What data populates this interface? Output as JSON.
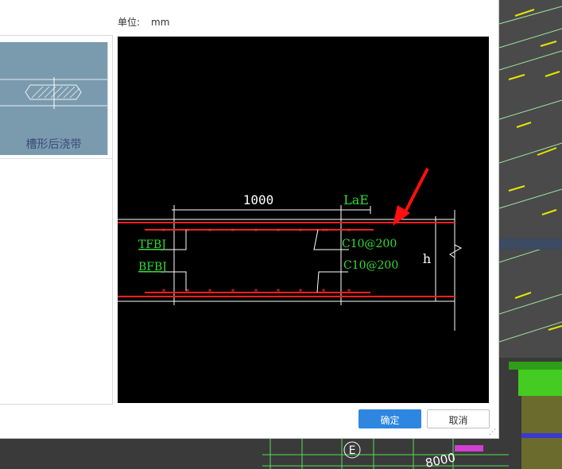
{
  "dialog": {
    "unit_label": "单位:",
    "unit_value": "mm",
    "thumbnail_label": "槽形后浇带",
    "ok_label": "确定",
    "cancel_label": "取消"
  },
  "drawing": {
    "dim_width": "1000",
    "dim_lae": "LaE",
    "top_bar_label": "TFBJ",
    "bottom_bar_label": "BFBJ",
    "top_stirrup_label": "C10@200",
    "bottom_stirrup_label": "C10@200",
    "height_label": "h"
  },
  "background": {
    "axis_label": "E",
    "dimension_label": "8000"
  },
  "colors": {
    "primary_button": "#2d86e0",
    "rebar_red": "#ff2020",
    "label_green": "#33dd33",
    "cad_white": "#ffffff"
  }
}
